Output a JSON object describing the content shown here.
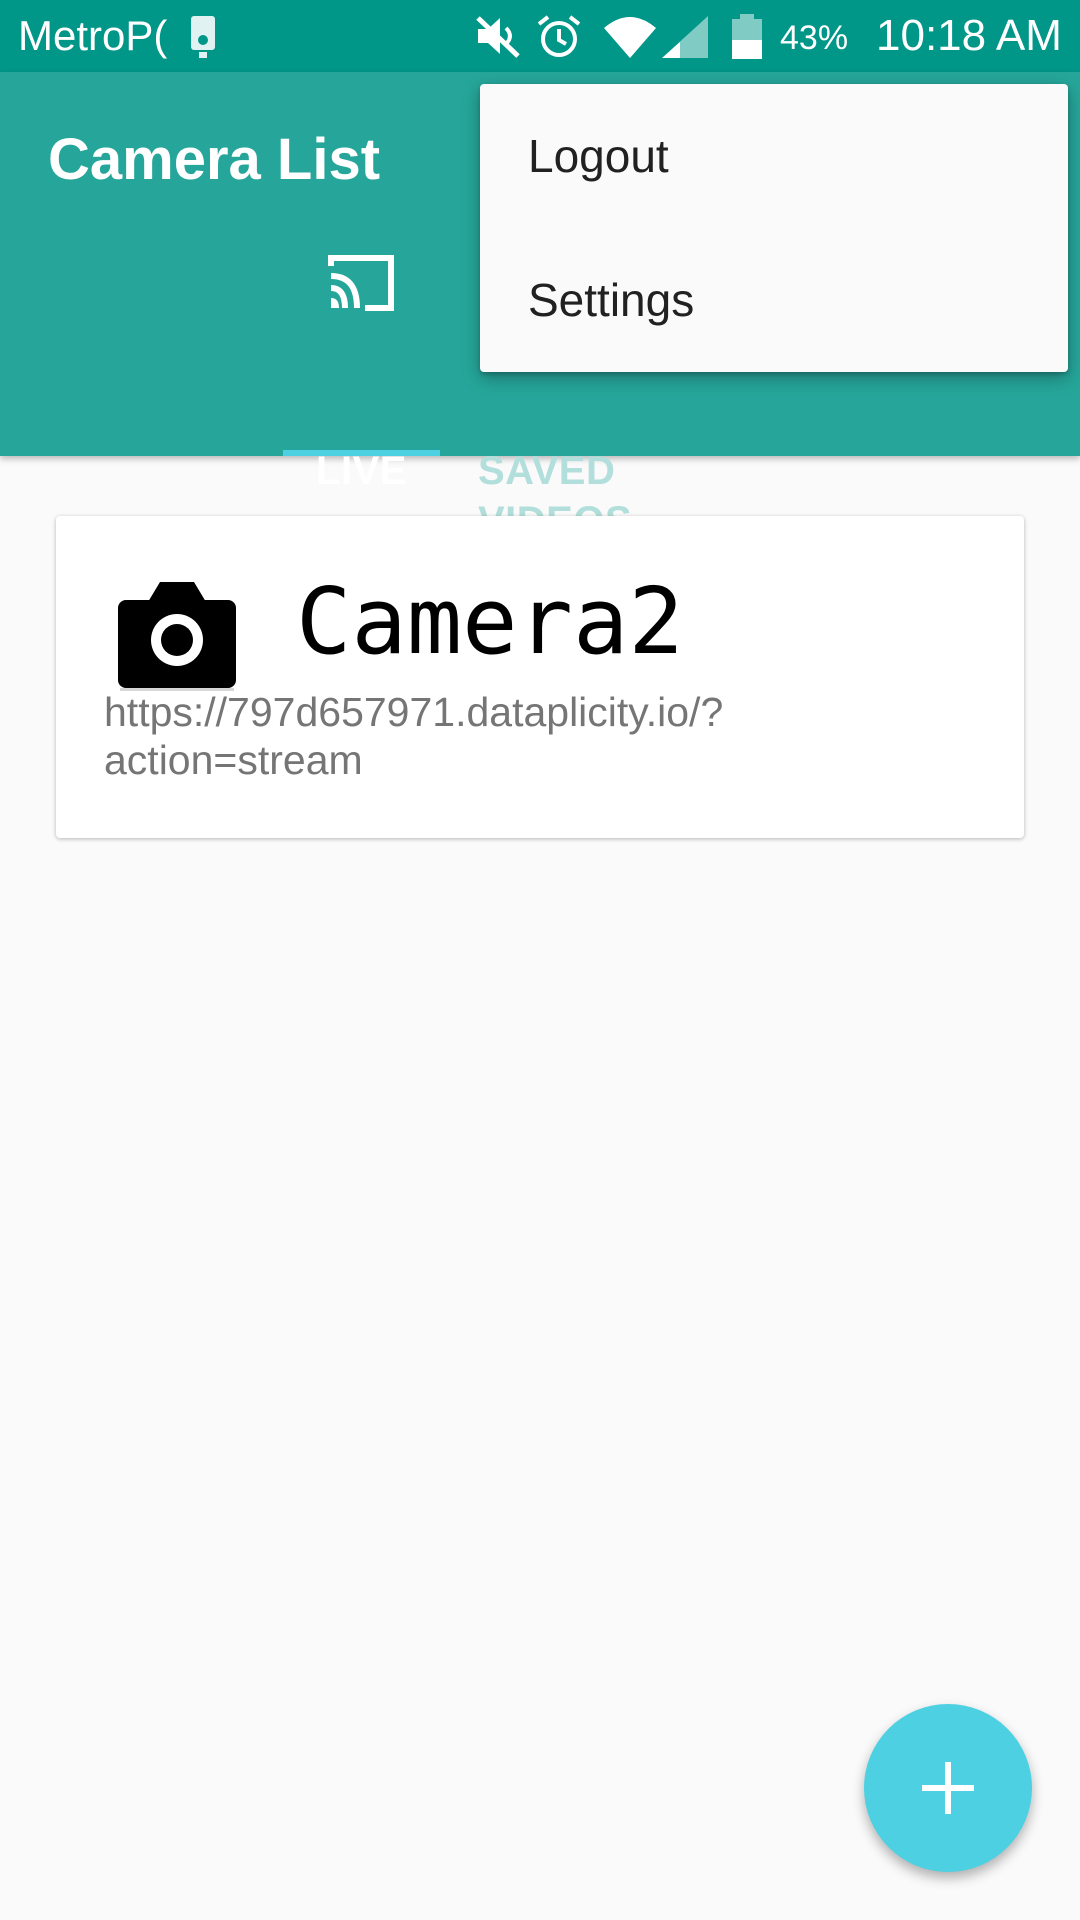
{
  "status_bar": {
    "carrier": "MetroP(",
    "battery_percent": "43%",
    "time": "10:18 AM",
    "icons": [
      "voicemail-icon",
      "mute-icon",
      "alarm-icon",
      "wifi-icon",
      "cell-signal-icon",
      "battery-icon"
    ]
  },
  "app_bar": {
    "title": "Camera List",
    "tabs": [
      {
        "label": "LIVE",
        "icon": "cast-icon",
        "selected": true
      },
      {
        "label": "SAVED VIDEOS",
        "selected": false
      }
    ]
  },
  "menu": {
    "items": [
      {
        "label": "Logout"
      },
      {
        "label": "Settings"
      }
    ]
  },
  "cameras": [
    {
      "name": "Camera2",
      "url": "https://797d657971.dataplicity.io/?action=stream",
      "icon": "camera-icon"
    }
  ],
  "fab": {
    "icon": "add-icon"
  },
  "colors": {
    "status_bar": "#009688",
    "app_bar": "#26a69a",
    "tab_indicator": "#4dd0e1",
    "fab": "#4dd0e1",
    "inactive_tab": "#b2dfdb"
  }
}
